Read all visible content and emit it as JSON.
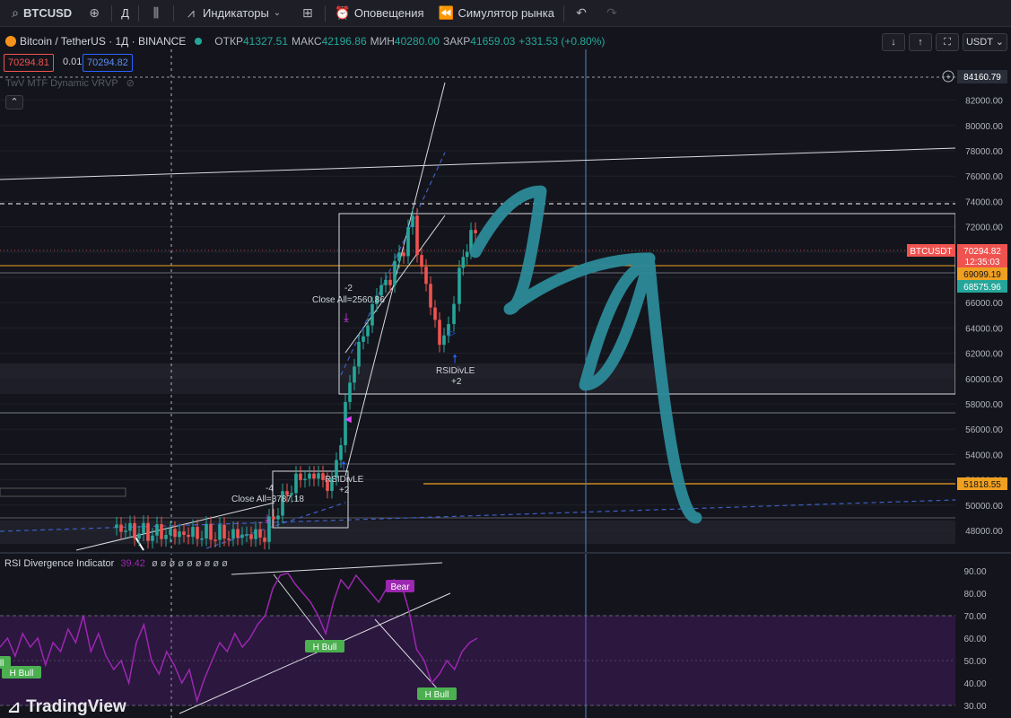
{
  "toolbar": {
    "symbol": "BTCUSD",
    "interval": "Д",
    "indicators_label": "Индикаторы",
    "alerts_label": "Оповещения",
    "replay_label": "Симулятор рынка"
  },
  "legend": {
    "title": "Bitcoin / TetherUS · 1Д · BINANCE",
    "open_label": "ОТКР",
    "open": "41327.51",
    "high_label": "МАКС",
    "high": "42196.86",
    "low_label": "МИН",
    "low": "40280.00",
    "close_label": "ЗАКР",
    "close": "41659.03",
    "change": "+331.53 (+0.80%)",
    "sell_price": "70294.81",
    "spread": "0.01",
    "buy_price": "70294.82",
    "vrvp_label": "TwV MTF Dynamic VRVP"
  },
  "currency": "USDT",
  "rsi": {
    "title": "RSI Divergence Indicator",
    "value": "39.42",
    "nans": "ø ø ø ø ø ø ø ø ø"
  },
  "brand": {
    "name": "TradingView"
  },
  "colors": {
    "up": "#26a69a",
    "down": "#ef5350",
    "rsi": "#9c27b0",
    "arrow": "#2b8a99",
    "orange": "#f0a020",
    "accent": "#2962ff"
  },
  "chart_data": [
    {
      "type": "candlestick",
      "title": "Bitcoin / TetherUS · 1Д · BINANCE",
      "y_axis_ticks": [
        48000,
        50000,
        52000,
        54000,
        56000,
        58000,
        60000,
        62000,
        64000,
        66000,
        68000,
        70000,
        72000,
        74000,
        76000,
        78000,
        80000,
        82000
      ],
      "ylim": [
        46500,
        84500
      ],
      "price_labels": [
        {
          "text": "84160.79",
          "kind": "crosshair"
        },
        {
          "text": "BTCUSDT",
          "kind": "symbol"
        },
        {
          "text": "70294.82",
          "kind": "last"
        },
        {
          "text": "12:35:03",
          "kind": "countdown"
        },
        {
          "text": "69099.19",
          "kind": "level"
        },
        {
          "text": "68575.96",
          "kind": "level"
        },
        {
          "text": "51818.55",
          "kind": "level"
        }
      ],
      "annotations": [
        "Close All=2560.86",
        "-2",
        "RSIDivLE",
        "+2",
        "Close All=3787.18",
        "-4",
        "RSIDivLE",
        "+2"
      ],
      "projection_path": [
        70000,
        74800,
        65500,
        69500,
        59500,
        69000,
        49000
      ]
    },
    {
      "type": "line",
      "title": "RSI Divergence Indicator",
      "y_axis_ticks": [
        30,
        40,
        50,
        60,
        70,
        80,
        90
      ],
      "ylim": [
        28,
        94
      ],
      "series": [
        {
          "values": [
            56,
            60,
            52,
            62,
            56,
            60,
            48,
            58,
            54,
            64,
            58,
            70,
            54,
            62,
            52,
            46,
            50,
            40,
            58,
            66,
            50,
            44,
            54,
            48,
            40,
            46,
            32,
            42,
            50,
            58,
            54,
            62,
            56,
            60,
            66,
            70,
            82,
            88,
            89,
            84,
            80,
            76,
            70,
            62,
            76,
            86,
            82,
            88,
            84,
            80,
            76,
            82,
            86,
            84,
            72,
            55,
            50,
            40,
            44,
            50,
            46,
            54,
            58,
            60
          ]
        }
      ],
      "labels": [
        "Bear",
        "H Bull",
        "H Bull",
        "Bull",
        "H Bull"
      ]
    }
  ]
}
